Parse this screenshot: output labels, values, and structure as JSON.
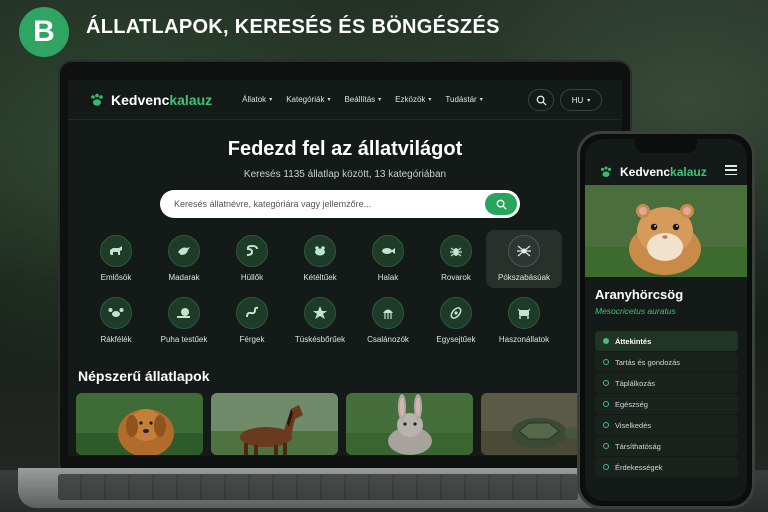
{
  "heading": {
    "badge": "B",
    "title": "ÁLLATLAPOK, KERESÉS ÉS BÖNGÉSZÉS"
  },
  "colors": {
    "accent": "#2fa463",
    "background": "#141a17"
  },
  "desktop": {
    "brand": {
      "prefix": "Kedvenc",
      "suffix": "kalauz"
    },
    "nav": [
      {
        "label": "Állatok"
      },
      {
        "label": "Kategóriák"
      },
      {
        "label": "Beállítás"
      },
      {
        "label": "Ezközök"
      },
      {
        "label": "Tudástár"
      }
    ],
    "language": "HU",
    "hero_title": "Fedezd fel az állatvilágot",
    "hero_subtitle": "Keresés 1135 állatlap között, 13 kategóriában",
    "search_placeholder": "Keresés állatnévre, kategóriára vagy jellemzőre...",
    "categories": [
      {
        "label": "Emlősök",
        "icon": "dog-icon"
      },
      {
        "label": "Madarak",
        "icon": "bird-icon"
      },
      {
        "label": "Hüllők",
        "icon": "snake-icon"
      },
      {
        "label": "Kétéltűek",
        "icon": "frog-icon"
      },
      {
        "label": "Halak",
        "icon": "fish-icon"
      },
      {
        "label": "Rovarok",
        "icon": "insect-icon"
      },
      {
        "label": "Pókszabásúak",
        "icon": "spider-icon"
      },
      {
        "label": "Rákfélék",
        "icon": "crab-icon"
      },
      {
        "label": "Puha testűek",
        "icon": "snail-icon"
      },
      {
        "label": "Férgek",
        "icon": "worm-icon"
      },
      {
        "label": "Tüskésbőrűek",
        "icon": "starfish-icon"
      },
      {
        "label": "Csalánozók",
        "icon": "jellyfish-icon"
      },
      {
        "label": "Egysejtűek",
        "icon": "cell-icon"
      },
      {
        "label": "Haszonállatok",
        "icon": "cow-icon"
      }
    ],
    "popular_title": "Népszerű állatlapok",
    "popular": [
      {
        "icon": "golden-retriever-photo"
      },
      {
        "icon": "horse-photo"
      },
      {
        "icon": "rabbit-photo"
      },
      {
        "icon": "turtle-photo"
      }
    ]
  },
  "mobile": {
    "brand": {
      "prefix": "Kedvenc",
      "suffix": "kalauz"
    },
    "animal_name": "Aranyhörcsög",
    "latin_name": "Mesocricetus auratus",
    "sections": [
      {
        "label": "Áttekintés",
        "active": true
      },
      {
        "label": "Tartás és gondozás",
        "active": false
      },
      {
        "label": "Táplálkozás",
        "active": false
      },
      {
        "label": "Egészség",
        "active": false
      },
      {
        "label": "Viselkedés",
        "active": false
      },
      {
        "label": "Társíthatóság",
        "active": false
      },
      {
        "label": "Érdekességek",
        "active": false
      }
    ]
  }
}
